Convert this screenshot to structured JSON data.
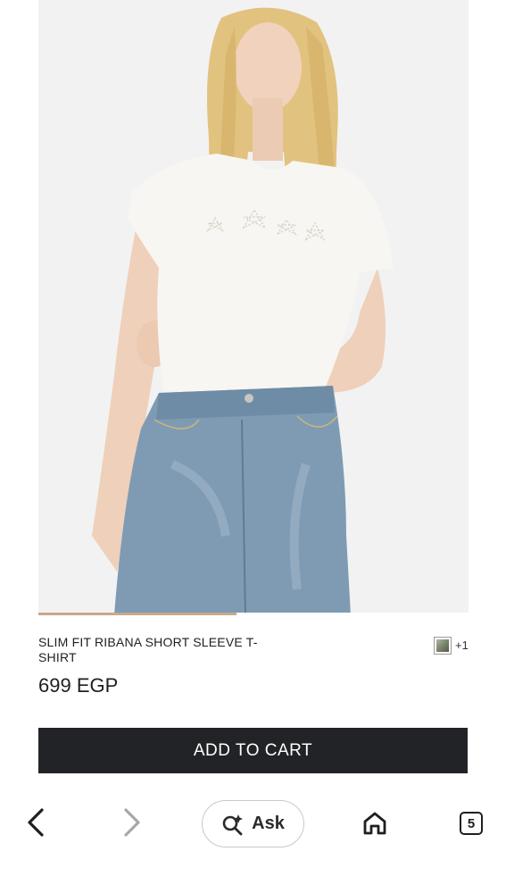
{
  "product": {
    "name": "SLIM FIT RIBANA SHORT SLEEVE T-SHIRT",
    "price": "699 EGP",
    "image_alt": "Model wearing white slim fit ribbed short sleeve t-shirt with rhinestone stars and blue jeans",
    "color_swatch_extra": "+1",
    "image_carousel_progress": 0.46
  },
  "actions": {
    "add_to_cart": "ADD TO CART"
  },
  "browser_bar": {
    "ask_label": "Ask",
    "tab_count": "5",
    "icons": [
      "back-arrow-icon",
      "forward-arrow-icon",
      "ask-sparkle-search-icon",
      "home-icon",
      "tabs-icon"
    ]
  },
  "colors": {
    "button_bg": "#222326",
    "image_bg": "#f2f2f3",
    "progress": "#c9a98a"
  }
}
